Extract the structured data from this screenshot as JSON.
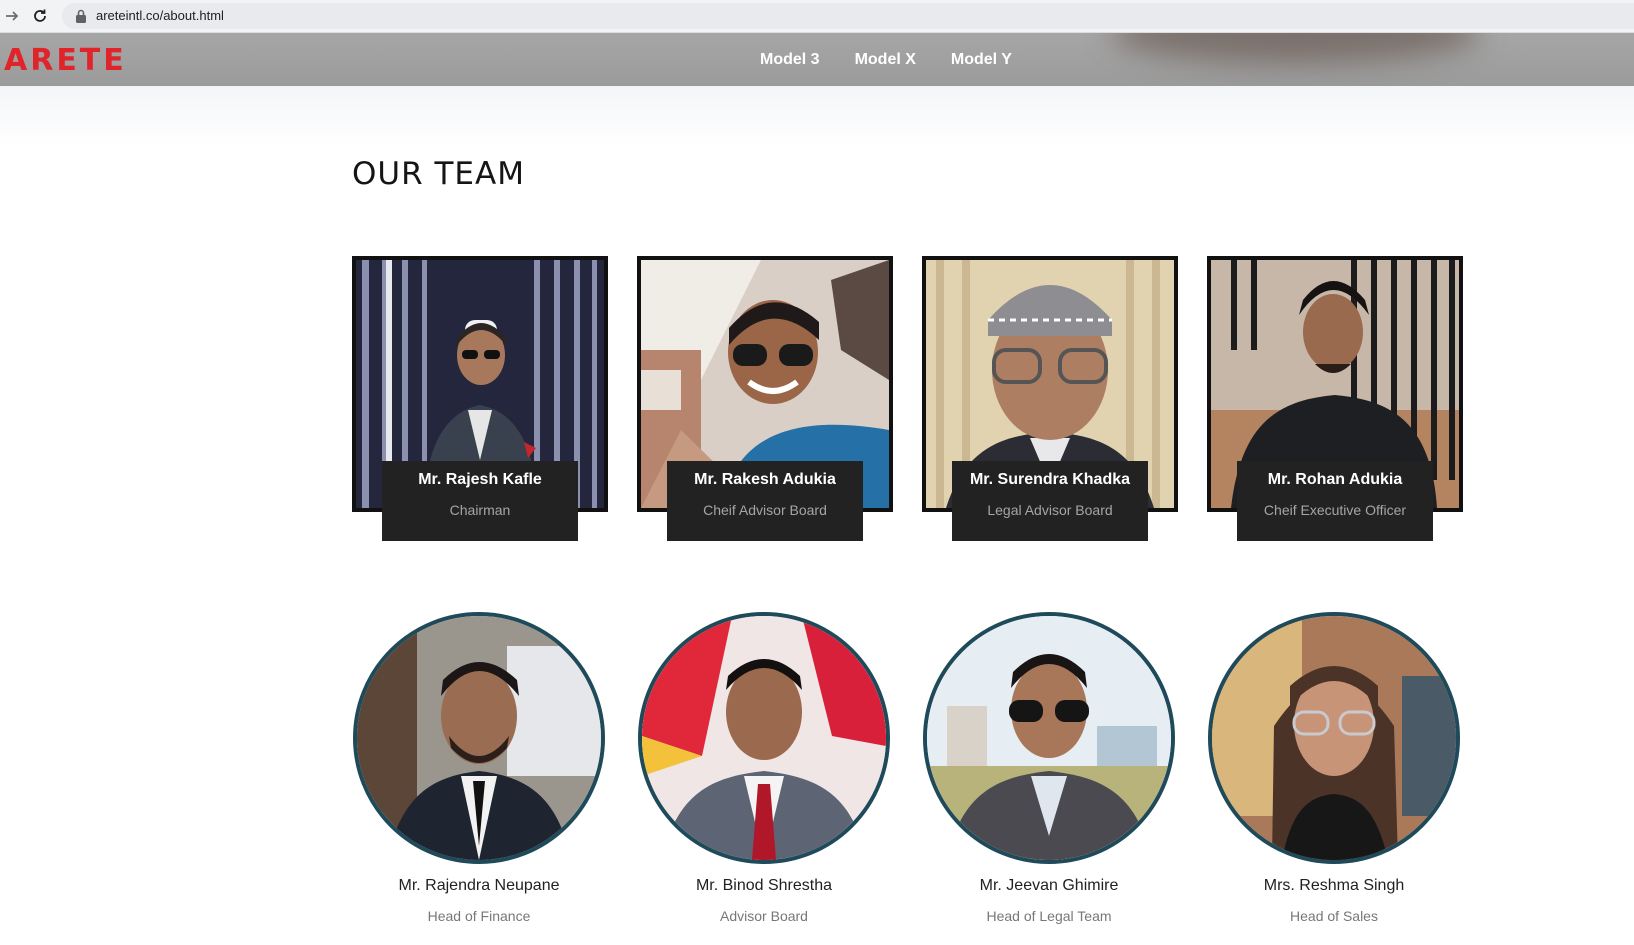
{
  "browser": {
    "back_icon": "arrow-right-icon",
    "reload_icon": "reload-icon",
    "lock_icon": "lock-icon",
    "url": "areteintl.co/about.html"
  },
  "header": {
    "logo": "ARETE",
    "brand_color": "#e0242a",
    "nav": [
      {
        "label": "Model 3"
      },
      {
        "label": "Model X"
      },
      {
        "label": "Model Y"
      }
    ]
  },
  "main": {
    "title": "OUR TEAM",
    "leaders": [
      {
        "name": "Mr. Rajesh Kafle",
        "role": "Chairman"
      },
      {
        "name": "Mr. Rakesh Adukia",
        "role": "Cheif Advisor Board"
      },
      {
        "name": "Mr. Surendra Khadka",
        "role": "Legal Advisor Board"
      },
      {
        "name": "Mr. Rohan Adukia",
        "role": "Cheif Executive Officer"
      }
    ],
    "members": [
      {
        "name": "Mr. Rajendra Neupane",
        "role": "Head of Finance"
      },
      {
        "name": "Mr. Binod Shrestha",
        "role": "Advisor Board"
      },
      {
        "name": "Mr. Jeevan Ghimire",
        "role": "Head of Legal Team"
      },
      {
        "name": "Mrs. Reshma Singh",
        "role": "Head of Sales"
      }
    ]
  }
}
